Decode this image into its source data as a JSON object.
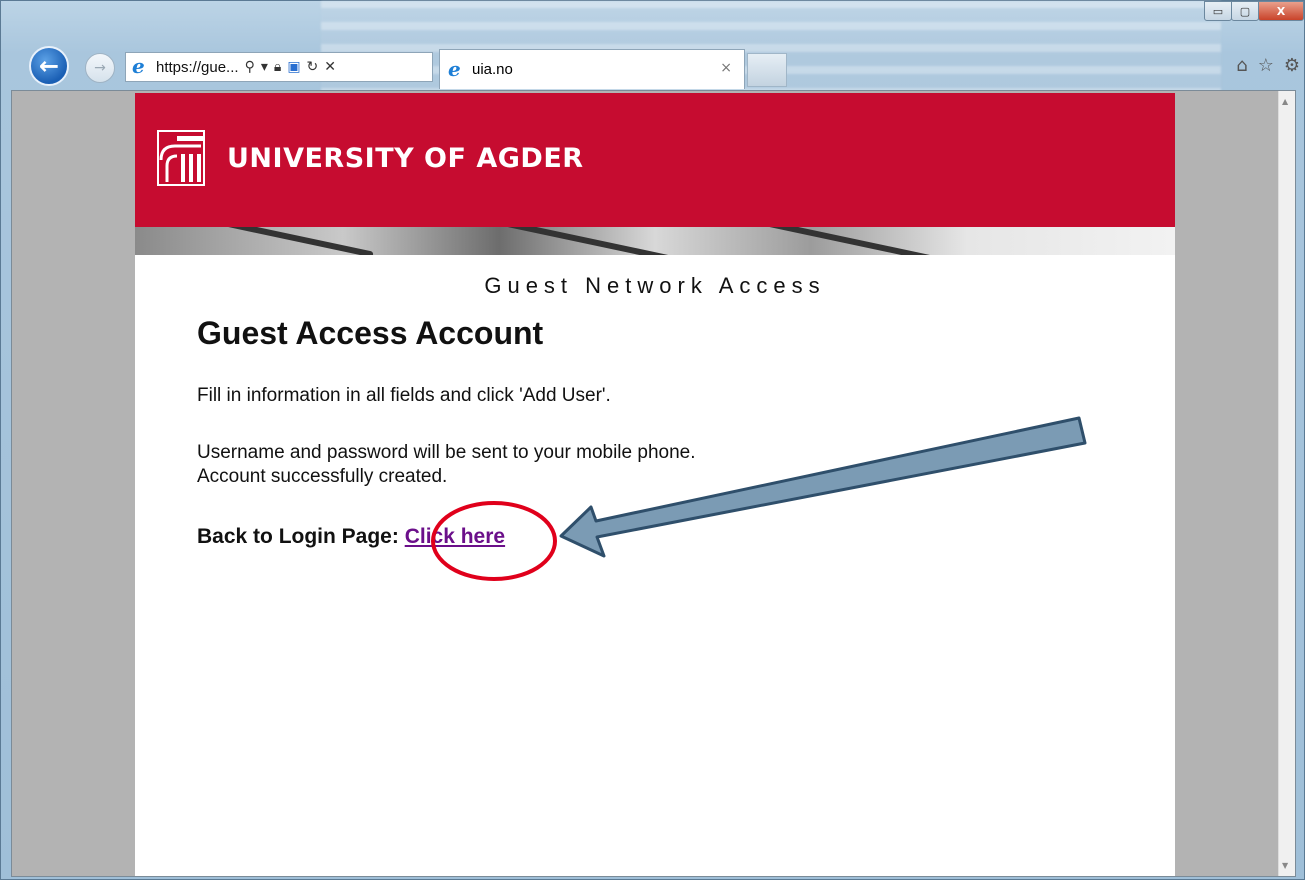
{
  "browser": {
    "address_text": "https://gue...",
    "tab_title": "uia.no",
    "tab_close": "×",
    "window_buttons": {
      "minimize": "▭",
      "restore": "▢",
      "close": "X"
    }
  },
  "page": {
    "university_name": "UNIVERSITY OF AGDER",
    "subtitle": "Guest Network Access",
    "heading": "Guest Access Account",
    "instruction": "Fill in information in all fields and click 'Add User'.",
    "sms_notice": "Username and password will be sent to your mobile phone.",
    "success_message": "Account successfully created.",
    "back_label": "Back to Login Page:",
    "click_here": "Click here"
  },
  "colors": {
    "banner_red": "#c60c30",
    "link_purple": "#6b0f8a",
    "annotation_red": "#e0001b",
    "arrow_blue": "#7b9bb4"
  },
  "icons": [
    "back-arrow-icon",
    "forward-arrow-icon",
    "ie-icon",
    "search-icon",
    "lock-icon",
    "refresh-icon",
    "stop-icon",
    "home-icon",
    "favorites-icon",
    "settings-icon"
  ]
}
